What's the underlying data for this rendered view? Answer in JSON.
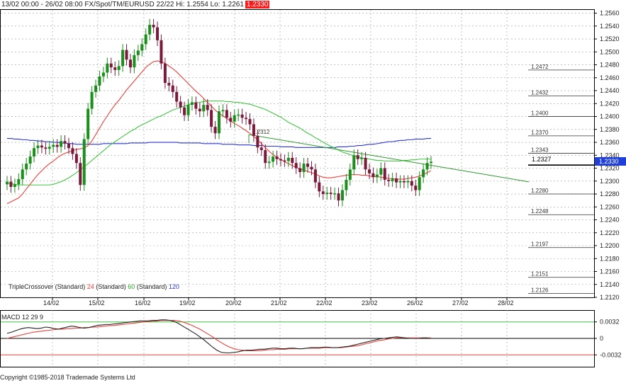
{
  "header": {
    "info": "13/02 00:00 - 26/02 08:00 FX/Spot/TM/EURUSD 22/22 Hi: 1.2554 Lo: 1.2261",
    "last": "1.2330"
  },
  "legend": {
    "prefix": "TripleCrossover (Standard)",
    "p24": "24",
    "std1": "(Standard)",
    "p60": "60",
    "std2": "(Standard)",
    "p120": "120"
  },
  "macd": {
    "title": "MACD 12 29 9",
    "ticks": [
      "0.0032",
      "0",
      "-0.0032"
    ]
  },
  "copyright": "Copyright ©1985-2018 Trademade Systems Ltd",
  "price_axis": [
    "1.2560",
    "1.2540",
    "1.2520",
    "1.2500",
    "1.2480",
    "1.2460",
    "1.2440",
    "1.2420",
    "1.2400",
    "1.2380",
    "1.2360",
    "1.2340",
    "1.2320",
    "1.2300",
    "1.2280",
    "1.2260",
    "1.2240",
    "1.2220",
    "1.2200",
    "1.2180",
    "1.2160",
    "1.2140",
    "1.2120"
  ],
  "date_axis": [
    "14/02",
    "15/02",
    "16/02",
    "19/02",
    "20/02",
    "21/02",
    "22/02",
    "23/02",
    "26/02",
    "27/02",
    "28/02"
  ],
  "levels": [
    "1.2472",
    "1.2432",
    "1.2400",
    "1.2370",
    "1.2343",
    "1.2280",
    "1.2248",
    "1.2197",
    "1.2151",
    "1.2126"
  ],
  "current_price": "1.2327",
  "price_tag": "1.2330",
  "trend_label": "1.2312",
  "colors": {
    "up": "#1a8f1a",
    "down": "#7a1a3a",
    "ma24": "#e8423c",
    "ma60": "#41c441",
    "ma120": "#2b35d6",
    "macd": "#222222",
    "signal": "#e8423c",
    "grid": "#9a9a9a"
  },
  "chart_data": {
    "type": "candlestick",
    "symbol": "EURUSD",
    "ylim": [
      1.212,
      1.2565
    ],
    "hi": 1.2554,
    "lo": 1.2261,
    "closes": [
      1.2299,
      1.2291,
      1.2295,
      1.2303,
      1.2318,
      1.2327,
      1.2338,
      1.2351,
      1.2355,
      1.2352,
      1.235,
      1.2353,
      1.2356,
      1.2353,
      1.2362,
      1.2358,
      1.2351,
      1.2342,
      1.2328,
      1.2294,
      1.2365,
      1.2412,
      1.2438,
      1.2448,
      1.2462,
      1.2468,
      1.2482,
      1.2476,
      1.2472,
      1.2478,
      1.2503,
      1.2488,
      1.2476,
      1.2495,
      1.2502,
      1.2512,
      1.2527,
      1.2542,
      1.2538,
      1.2518,
      1.2482,
      1.2452,
      1.2448,
      1.2438,
      1.2423,
      1.2414,
      1.2402,
      1.2418,
      1.2422,
      1.2412,
      1.2408,
      1.2418,
      1.241,
      1.2384,
      1.2374,
      1.2408,
      1.241,
      1.2398,
      1.2392,
      1.2402,
      1.2403,
      1.2398,
      1.2396,
      1.2388,
      1.237,
      1.2352,
      1.2348,
      1.2328,
      1.233,
      1.2338,
      1.2334,
      1.2332,
      1.2331,
      1.2336,
      1.2328,
      1.232,
      1.2314,
      1.2327,
      1.2322,
      1.2318,
      1.2298,
      1.2284,
      1.228,
      1.2282,
      1.228,
      1.2281,
      1.227,
      1.2286,
      1.2302,
      1.2318,
      1.234,
      1.2334,
      1.2336,
      1.2318,
      1.2312,
      1.2306,
      1.231,
      1.232,
      1.2302,
      1.23,
      1.2304,
      1.2298,
      1.23,
      1.2298,
      1.23,
      1.2293,
      1.2286,
      1.2306,
      1.2318,
      1.2328,
      1.233
    ],
    "ma24": [
      1.2265,
      1.2268,
      1.2271,
      1.2274,
      1.228,
      1.2288,
      1.2295,
      1.2303,
      1.231,
      1.2316,
      1.2322,
      1.2327,
      1.2331,
      1.2336,
      1.234,
      1.2343,
      1.2345,
      1.2347,
      1.2349,
      1.235,
      1.2351,
      1.2355,
      1.2362,
      1.2372,
      1.2382,
      1.2392,
      1.2401,
      1.241,
      1.2418,
      1.2425,
      1.2433,
      1.2441,
      1.2448,
      1.2455,
      1.2462,
      1.2469,
      1.2476,
      1.2481,
      1.2485,
      1.2486,
      1.2485,
      1.2482,
      1.2478,
      1.2474,
      1.2469,
      1.2463,
      1.2457,
      1.2451,
      1.2445,
      1.2439,
      1.2434,
      1.2428,
      1.2422,
      1.2416,
      1.241,
      1.2405,
      1.2401,
      1.2397,
      1.2393,
      1.2389,
      1.2386,
      1.2382,
      1.2378,
      1.2374,
      1.2369,
      1.2364,
      1.2358,
      1.2352,
      1.2346,
      1.2341,
      1.2337,
      1.2333,
      1.233,
      1.2327,
      1.2324,
      1.2321,
      1.2319,
      1.2317,
      1.2315,
      1.2313,
      1.2311,
      1.2308,
      1.2306,
      1.2305,
      1.2305,
      1.2306,
      1.2307,
      1.2308,
      1.2309,
      1.231,
      1.231,
      1.231,
      1.2309,
      1.2309,
      1.2308,
      1.2307,
      1.2307,
      1.2306,
      1.2305,
      1.2304,
      1.2304,
      1.2303,
      1.2303,
      1.2303,
      1.2304,
      1.2305,
      1.2306,
      1.2308,
      1.231,
      1.2313,
      1.2316
    ],
    "ma60": [
      1.2297,
      1.2296,
      1.2295,
      1.2294,
      1.2294,
      1.2294,
      1.2294,
      1.2294,
      1.2294,
      1.2294,
      1.2294,
      1.2294,
      1.2295,
      1.2297,
      1.2299,
      1.2302,
      1.2305,
      1.2309,
      1.2313,
      1.2318,
      1.2322,
      1.2327,
      1.2332,
      1.2337,
      1.2342,
      1.2347,
      1.2352,
      1.2357,
      1.2361,
      1.2365,
      1.2369,
      1.2373,
      1.2377,
      1.238,
      1.2384,
      1.2387,
      1.239,
      1.2393,
      1.2396,
      1.2399,
      1.2401,
      1.2404,
      1.2407,
      1.241,
      1.2412,
      1.2414,
      1.2416,
      1.2418,
      1.242,
      1.2421,
      1.2422,
      1.2423,
      1.2424,
      1.2424,
      1.2424,
      1.2424,
      1.2424,
      1.2423,
      1.2423,
      1.2422,
      1.2422,
      1.2421,
      1.242,
      1.2419,
      1.2417,
      1.2415,
      1.2413,
      1.2411,
      1.2408,
      1.2405,
      1.2402,
      1.2399,
      1.2395,
      1.2391,
      1.2388,
      1.2385,
      1.2382,
      1.2378,
      1.2374,
      1.2371,
      1.2367,
      1.2364,
      1.236,
      1.2357,
      1.2354,
      1.2351,
      1.2348,
      1.2345,
      1.2343,
      1.2341,
      1.2339,
      1.2337,
      1.2336,
      1.2335,
      1.2334,
      1.2333,
      1.2332,
      1.2332,
      1.2331,
      1.2331,
      1.2331,
      1.2331,
      1.2331,
      1.2332,
      1.2332,
      1.2333,
      1.2333,
      1.2334,
      1.2334,
      1.2334,
      1.2334
    ],
    "ma120": [
      1.2366,
      1.2366,
      1.2365,
      1.2365,
      1.2364,
      1.2364,
      1.2363,
      1.2363,
      1.2362,
      1.2362,
      1.2361,
      1.2361,
      1.236,
      1.236,
      1.2359,
      1.2359,
      1.2358,
      1.2358,
      1.2357,
      1.2357,
      1.2357,
      1.2357,
      1.2357,
      1.2357,
      1.2357,
      1.2358,
      1.2358,
      1.2358,
      1.2358,
      1.2358,
      1.2358,
      1.2358,
      1.2359,
      1.2359,
      1.2359,
      1.2359,
      1.2359,
      1.236,
      1.236,
      1.236,
      1.236,
      1.236,
      1.236,
      1.236,
      1.236,
      1.2359,
      1.2359,
      1.2359,
      1.2359,
      1.2359,
      1.2359,
      1.2358,
      1.2358,
      1.2358,
      1.2358,
      1.2358,
      1.2357,
      1.2357,
      1.2357,
      1.2357,
      1.2356,
      1.2356,
      1.2356,
      1.2356,
      1.2355,
      1.2355,
      1.2355,
      1.2354,
      1.2354,
      1.2354,
      1.2354,
      1.2353,
      1.2353,
      1.2353,
      1.2353,
      1.2352,
      1.2352,
      1.2352,
      1.2352,
      1.2352,
      1.2352,
      1.2352,
      1.2352,
      1.2352,
      1.2352,
      1.2352,
      1.2353,
      1.2353,
      1.2353,
      1.2354,
      1.2354,
      1.2355,
      1.2355,
      1.2356,
      1.2357,
      1.2357,
      1.2358,
      1.2359,
      1.236,
      1.2361,
      1.2361,
      1.2362,
      1.2363,
      1.2363,
      1.2364,
      1.2364,
      1.2365,
      1.2365,
      1.2365,
      1.2366,
      1.2366
    ],
    "trendline": {
      "from": 1.2372,
      "to": 1.2312
    },
    "macd_ylim": [
      -0.0055,
      0.0055
    ],
    "macd_line": [
      0.001,
      0.0012,
      0.0015,
      0.0018,
      0.002,
      0.0021,
      0.002,
      0.0019,
      0.002,
      0.0022,
      0.0021,
      0.0019,
      0.0018,
      0.002,
      0.0022,
      0.0024,
      0.0023,
      0.0021,
      0.002,
      0.0021,
      0.0023,
      0.0025,
      0.0026,
      0.0027,
      0.0027,
      0.0028,
      0.0029,
      0.003,
      0.0031,
      0.0032,
      0.0033,
      0.0034,
      0.0034,
      0.0034,
      0.0035,
      0.0035,
      0.0036,
      0.0036,
      0.0035,
      0.0033,
      0.0029,
      0.0024,
      0.0019,
      0.0014,
      0.0009,
      0.0003,
      -0.0003,
      -0.001,
      -0.0017,
      -0.0023,
      -0.0027,
      -0.0028,
      -0.0028,
      -0.0027,
      -0.0026,
      -0.0024,
      -0.0023,
      -0.0023,
      -0.0022,
      -0.0021,
      -0.0021,
      -0.002,
      -0.0019,
      -0.0019,
      -0.002,
      -0.002,
      -0.0019,
      -0.0019,
      -0.002,
      -0.002,
      -0.0019,
      -0.0018,
      -0.0018,
      -0.0018,
      -0.0017,
      -0.0017,
      -0.0018,
      -0.0018,
      -0.0017,
      -0.0016,
      -0.0015,
      -0.0013,
      -0.0011,
      -0.0009,
      -0.0007,
      -0.0005,
      -0.0003,
      -0.0001,
      0.0,
      0.0001,
      0.0002,
      0.0003,
      0.0002,
      0.0001,
      0.0,
      0.0,
      0.0,
      0.0001,
      0.0001,
      0.0
    ],
    "signal_line": [
      0.0,
      0.0002,
      0.0004,
      0.0006,
      0.0008,
      0.001,
      0.0012,
      0.0013,
      0.0014,
      0.0015,
      0.0016,
      0.0017,
      0.0018,
      0.0018,
      0.0019,
      0.0019,
      0.002,
      0.002,
      0.0021,
      0.0021,
      0.0022,
      0.0022,
      0.0023,
      0.0024,
      0.0025,
      0.0025,
      0.0026,
      0.0027,
      0.0028,
      0.0029,
      0.003,
      0.0031,
      0.0032,
      0.0033,
      0.0033,
      0.0034,
      0.0035,
      0.0035,
      0.0035,
      0.0035,
      0.0034,
      0.0032,
      0.0029,
      0.0026,
      0.0022,
      0.0018,
      0.0013,
      0.0008,
      0.0003,
      -0.0003,
      -0.0008,
      -0.0013,
      -0.0017,
      -0.002,
      -0.0022,
      -0.0023,
      -0.0024,
      -0.0024,
      -0.0024,
      -0.0024,
      -0.0023,
      -0.0022,
      -0.0022,
      -0.0021,
      -0.0021,
      -0.0021,
      -0.002,
      -0.002,
      -0.002,
      -0.002,
      -0.0019,
      -0.0019,
      -0.0019,
      -0.0019,
      -0.0018,
      -0.0018,
      -0.0018,
      -0.0018,
      -0.0018,
      -0.0017,
      -0.0016,
      -0.0015,
      -0.0014,
      -0.0012,
      -0.001,
      -0.0008,
      -0.0006,
      -0.0004,
      -0.0003,
      -0.0001,
      0.0,
      0.0001,
      0.0001,
      0.0001,
      0.0001,
      0.0001,
      0.0001,
      0.0001,
      0.0001,
      0.0001
    ]
  }
}
